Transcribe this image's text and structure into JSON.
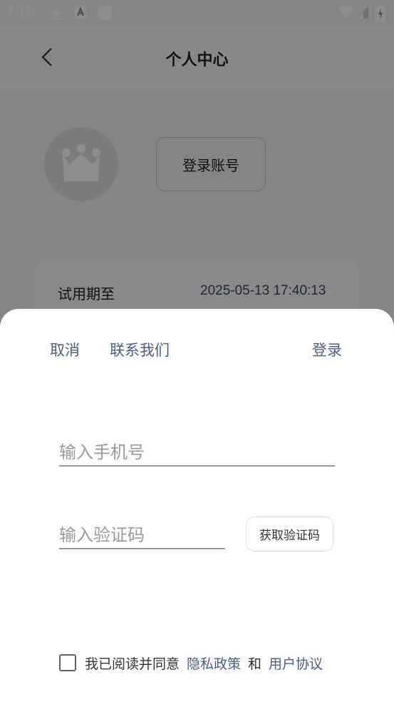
{
  "status_bar": {
    "time": "7:10"
  },
  "header": {
    "title": "个人中心"
  },
  "profile": {
    "login_button": "登录账号"
  },
  "trial": {
    "label": "试用期至",
    "value": "2025-05-13 17:40:13"
  },
  "sheet": {
    "cancel": "取消",
    "contact": "联系我们",
    "login": "登录",
    "phone_placeholder": "输入手机号",
    "code_placeholder": "输入验证码",
    "get_code": "获取验证码",
    "agree_text": "我已阅读并同意",
    "privacy_policy": "隐私政策",
    "and": "和",
    "user_agreement": "用户协议"
  }
}
